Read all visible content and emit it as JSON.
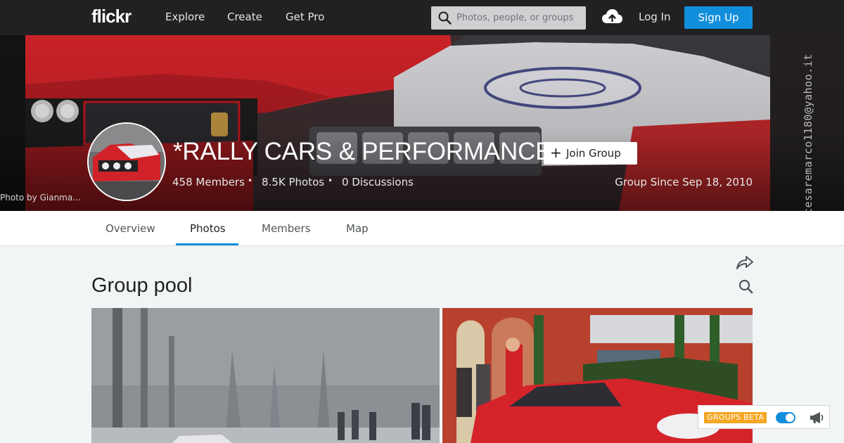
{
  "topbar": {
    "logo": "flickr",
    "nav": [
      "Explore",
      "Create",
      "Get Pro"
    ],
    "search_placeholder": "Photos, people, or groups",
    "login": "Log In",
    "signup": "Sign Up"
  },
  "hero": {
    "watermark": "cesaremarco1180@yahoo.it",
    "photo_credit": "Photo by Gianma...",
    "group_title": "*RALLY CARS & PERFORMANCE*",
    "join_label": "Join Group",
    "members": "458 Members",
    "photos": "8.5K Photos",
    "discussions": "0 Discussions",
    "since": "Group Since Sep 18, 2010"
  },
  "tabs": {
    "overview": "Overview",
    "photos": "Photos",
    "members": "Members",
    "map": "Map",
    "active": "Photos"
  },
  "main": {
    "title": "Group pool"
  },
  "beta": {
    "label": "GROUPS BETA",
    "enabled": true
  },
  "colors": {
    "accent": "#128fdc",
    "topbar": "#212124",
    "beta_badge": "#f5a623"
  },
  "icons": [
    "search-icon",
    "upload-cloud-icon",
    "plus-icon",
    "share-icon",
    "magnifier-icon",
    "megaphone-icon"
  ]
}
